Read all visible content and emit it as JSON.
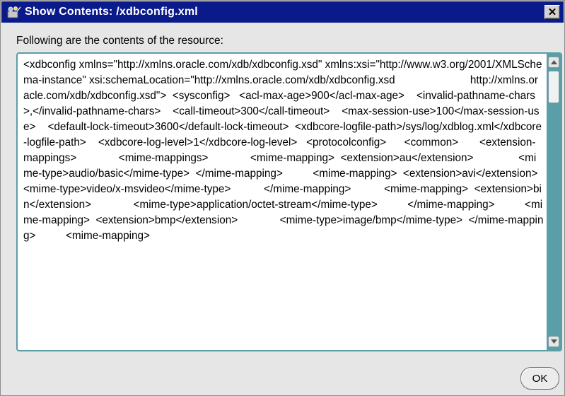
{
  "window": {
    "title": "Show Contents: /xdbconfig.xml",
    "close_glyph": "✕"
  },
  "label": "Following are the contents of the resource:",
  "content": "<xdbconfig xmlns=\"http://xmlns.oracle.com/xdb/xdbconfig.xsd\" xmlns:xsi=\"http://www.w3.org/2001/XMLSchema-instance\" xsi:schemaLocation=\"http://xmlns.oracle.com/xdb/xdbconfig.xsd                         http://xmlns.oracle.com/xdb/xdbconfig.xsd\">  <sysconfig>   <acl-max-age>900</acl-max-age>    <invalid-pathname-chars>,</invalid-pathname-chars>    <call-timeout>300</call-timeout>    <max-session-use>100</max-session-use>    <default-lock-timeout>3600</default-lock-timeout>  <xdbcore-logfile-path>/sys/log/xdblog.xml</xdbcore-logfile-path>    <xdbcore-log-level>1</xdbcore-log-level>   <protocolconfig>      <common>       <extension-mappings>              <mime-mappings>              <mime-mapping>  <extension>au</extension>               <mime-type>audio/basic</mime-type>  </mime-mapping>          <mime-mapping>  <extension>avi</extension>              <mime-type>video/x-msvideo</mime-type>           </mime-mapping>           <mime-mapping>  <extension>bin</extension>              <mime-type>application/octet-stream</mime-type>          </mime-mapping>          <mime-mapping>  <extension>bmp</extension>              <mime-type>image/bmp</mime-type>  </mime-mapping>          <mime-mapping>",
  "buttons": {
    "ok": "OK"
  },
  "colors": {
    "titlebar": "#0a1a8a",
    "scroll_track": "#5a9ea8"
  }
}
